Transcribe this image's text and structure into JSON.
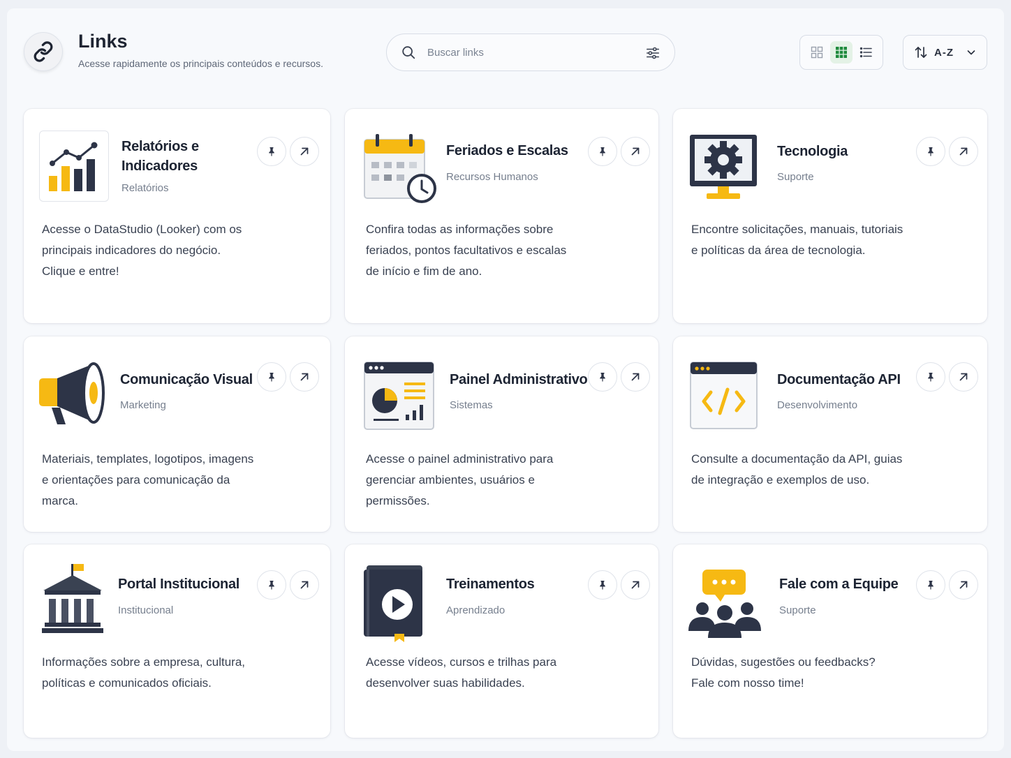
{
  "header": {
    "title": "Links",
    "subtitle": "Acesse rapidamente os principais conteúdos e recursos.",
    "logo_icon": "link-icon"
  },
  "search": {
    "placeholder": "Buscar links",
    "value": ""
  },
  "view_toggle": {
    "options": [
      "grid-small",
      "grid",
      "list"
    ],
    "active": "grid"
  },
  "sort": {
    "label": "A-Z"
  },
  "colors": {
    "accent_yellow": "#f6b913",
    "navy": "#2d3447",
    "active_green": "#1e8a3c"
  },
  "cards": [
    {
      "title": "Relatórios e Indicadores",
      "category": "Relatórios",
      "icon": "bar-chart-icon",
      "description": [
        "Acesse o DataStudio (Looker) com os",
        "principais indicadores do negócio.",
        "Clique e entre!"
      ]
    },
    {
      "title": "Feriados e Escalas",
      "category": "Recursos Humanos",
      "icon": "calendar-clock-icon",
      "description": [
        "Confira todas as informações sobre",
        "feriados, pontos facultativos e escalas",
        "de início e fim de ano."
      ]
    },
    {
      "title": "Tecnologia",
      "category": "Suporte",
      "icon": "monitor-gear-icon",
      "description": [
        "Encontre solicitações, manuais, tutoriais",
        "e políticas da área de tecnologia."
      ]
    },
    {
      "title": "Comunicação Visual",
      "category": "Marketing",
      "icon": "megaphone-icon",
      "description": [
        "Materiais, templates, logotipos, imagens",
        "e orientações para comunicação da",
        "marca."
      ]
    },
    {
      "title": "Painel Administrativo",
      "category": "Sistemas",
      "icon": "admin-dashboard-icon",
      "description": [
        "Acesse o painel administrativo para",
        "gerenciar ambientes, usuários e",
        "permissões."
      ]
    },
    {
      "title": "Documentação API",
      "category": "Desenvolvimento",
      "icon": "code-window-icon",
      "description": [
        "Consulte a documentação da API, guias",
        "de integração e exemplos de uso."
      ]
    },
    {
      "title": "Portal Institucional",
      "category": "Institucional",
      "icon": "institution-building-icon",
      "description": [
        "Informações sobre a empresa, cultura,",
        "políticas e comunicados oficiais."
      ]
    },
    {
      "title": "Treinamentos",
      "category": "Aprendizado",
      "icon": "video-book-icon",
      "description": [
        "Acesse vídeos, cursos e trilhas para",
        "desenvolver suas habilidades."
      ]
    },
    {
      "title": "Fale com a Equipe",
      "category": "Suporte",
      "icon": "team-chat-icon",
      "description": [
        "Dúvidas, sugestões ou feedbacks?",
        "Fale com nosso time!"
      ]
    }
  ]
}
